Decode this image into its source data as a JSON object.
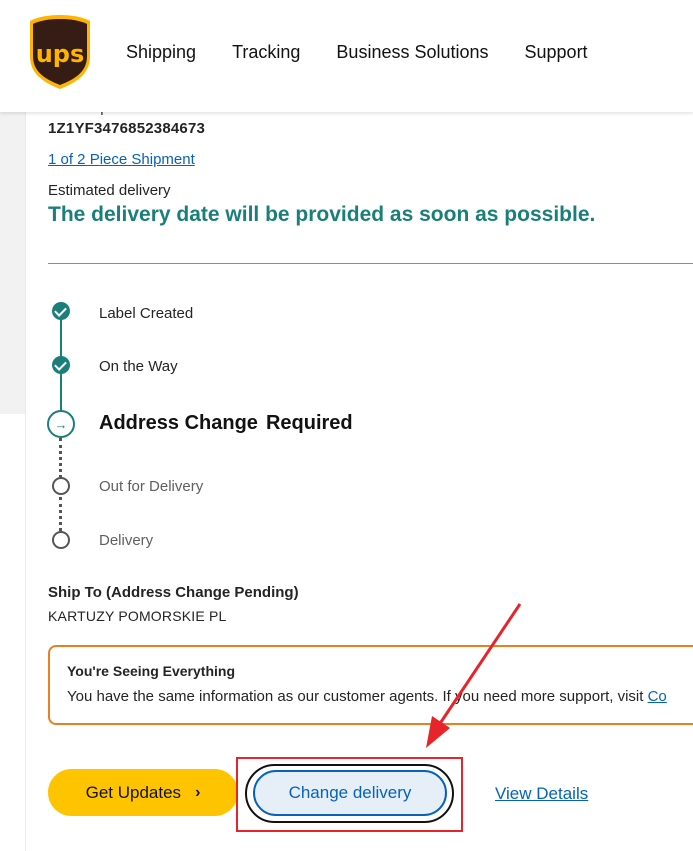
{
  "header": {
    "nav": [
      "Shipping",
      "Tracking",
      "Business Solutions",
      "Support"
    ],
    "brand_color": "#351c15",
    "brand_accent": "#ffb500"
  },
  "shipment": {
    "label_partial": "Your Shipment",
    "tracking_number": "1Z1YF3476852384673",
    "piece_link": "1 of 2 Piece Shipment",
    "est_label": "Estimated delivery",
    "est_value": "The delivery date will be provided as soon as possible."
  },
  "progress": {
    "steps": [
      {
        "label": "Label Created",
        "state": "done"
      },
      {
        "label": "On the Way",
        "state": "done"
      },
      {
        "label_a": "Address Change",
        "label_b": "Required",
        "state": "current"
      },
      {
        "label": "Out for Delivery",
        "state": "future"
      },
      {
        "label": "Delivery",
        "state": "future"
      }
    ],
    "current_icon": "arrow-right-icon",
    "accent_color": "#1a7f7a"
  },
  "ship_to": {
    "title": "Ship To (Address Change Pending)",
    "value": "KARTUZY POMORSKIE PL"
  },
  "info": {
    "title": "You're Seeing Everything",
    "text": "You have the same information as our customer agents. If you need more support, visit ",
    "link": "Co"
  },
  "actions": {
    "get_updates": "Get Updates",
    "change_delivery": "Change delivery",
    "view_details": "View Details"
  },
  "annotation": {
    "color": "#e8242b"
  }
}
